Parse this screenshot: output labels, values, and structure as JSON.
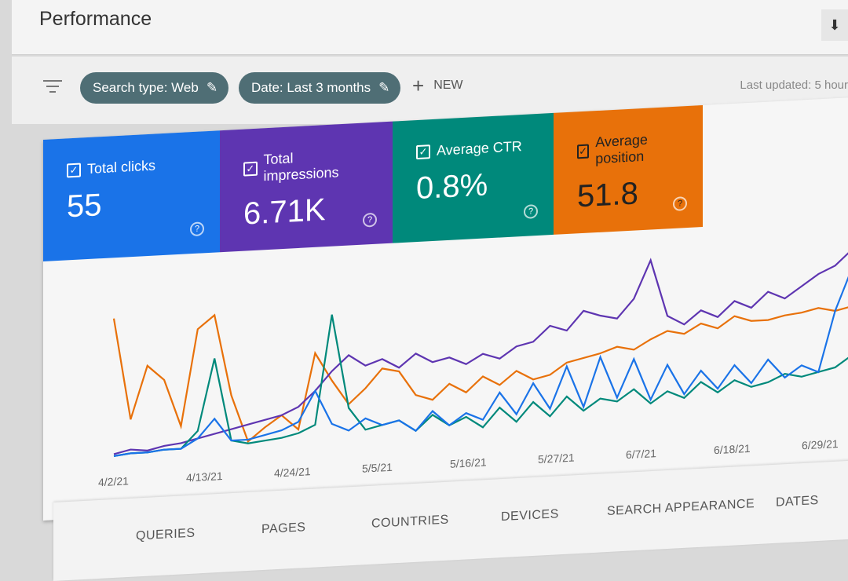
{
  "header": {
    "title": "Performance",
    "download_icon": "download-icon"
  },
  "filters": {
    "chips": [
      {
        "label": "Search type: Web",
        "icon": "pencil-icon"
      },
      {
        "label": "Date: Last 3 months",
        "icon": "pencil-icon"
      }
    ],
    "new_label": "NEW",
    "last_updated": "Last updated: 5 hour"
  },
  "metrics": [
    {
      "label": "Total clicks",
      "value": "55",
      "color": "#1a73e8",
      "checked": true
    },
    {
      "label": "Total impressions",
      "value": "6.71K",
      "color": "#5e35b1",
      "checked": true
    },
    {
      "label": "Average CTR",
      "value": "0.8%",
      "color": "#00897b",
      "checked": true
    },
    {
      "label": "Average position",
      "value": "51.8",
      "color": "#e8710a",
      "checked": true
    }
  ],
  "chart_data": {
    "type": "line",
    "x_tick_labels": [
      "4/2/21",
      "4/13/21",
      "4/24/21",
      "5/5/21",
      "5/16/21",
      "5/27/21",
      "6/7/21",
      "6/18/21",
      "6/29/21"
    ],
    "grid": false,
    "series": [
      {
        "name": "Average position",
        "color": "#e8710a",
        "values": [
          74,
          20,
          48,
          40,
          15,
          66,
          73,
          30,
          5,
          12,
          18,
          10,
          50,
          35,
          22,
          30,
          40,
          38,
          25,
          22,
          30,
          25,
          33,
          28,
          35,
          30,
          32,
          38,
          40,
          42,
          45,
          43,
          48,
          52,
          50,
          55,
          52,
          58,
          55,
          55,
          57,
          58,
          60,
          58,
          60
        ]
      },
      {
        "name": "Total impressions",
        "color": "#5e35b1",
        "values": [
          2,
          4,
          3,
          5,
          6,
          8,
          10,
          12,
          14,
          16,
          18,
          22,
          30,
          40,
          48,
          42,
          45,
          40,
          47,
          42,
          44,
          40,
          45,
          42,
          48,
          50,
          58,
          55,
          65,
          62,
          60,
          70,
          90,
          60,
          55,
          62,
          58,
          66,
          62,
          70,
          66,
          72,
          78,
          82,
          90
        ]
      },
      {
        "name": "Average CTR",
        "color": "#00897b",
        "values": [
          1,
          2,
          2,
          3,
          3,
          12,
          50,
          6,
          4,
          5,
          6,
          8,
          12,
          70,
          20,
          8,
          10,
          12,
          6,
          14,
          8,
          12,
          6,
          16,
          8,
          18,
          10,
          20,
          12,
          18,
          16,
          22,
          14,
          20,
          16,
          24,
          18,
          24,
          20,
          22,
          26,
          24,
          26,
          28,
          34
        ]
      },
      {
        "name": "Total clicks",
        "color": "#1a73e8",
        "values": [
          1,
          2,
          2,
          3,
          3,
          8,
          18,
          6,
          6,
          8,
          10,
          14,
          30,
          12,
          8,
          14,
          10,
          12,
          6,
          16,
          8,
          14,
          10,
          24,
          12,
          28,
          14,
          36,
          14,
          40,
          18,
          38,
          16,
          34,
          18,
          30,
          20,
          32,
          22,
          34,
          24,
          30,
          26,
          58,
          80
        ]
      }
    ]
  },
  "tabs": [
    "QUERIES",
    "PAGES",
    "COUNTRIES",
    "DEVICES",
    "SEARCH APPEARANCE",
    "DATES"
  ]
}
